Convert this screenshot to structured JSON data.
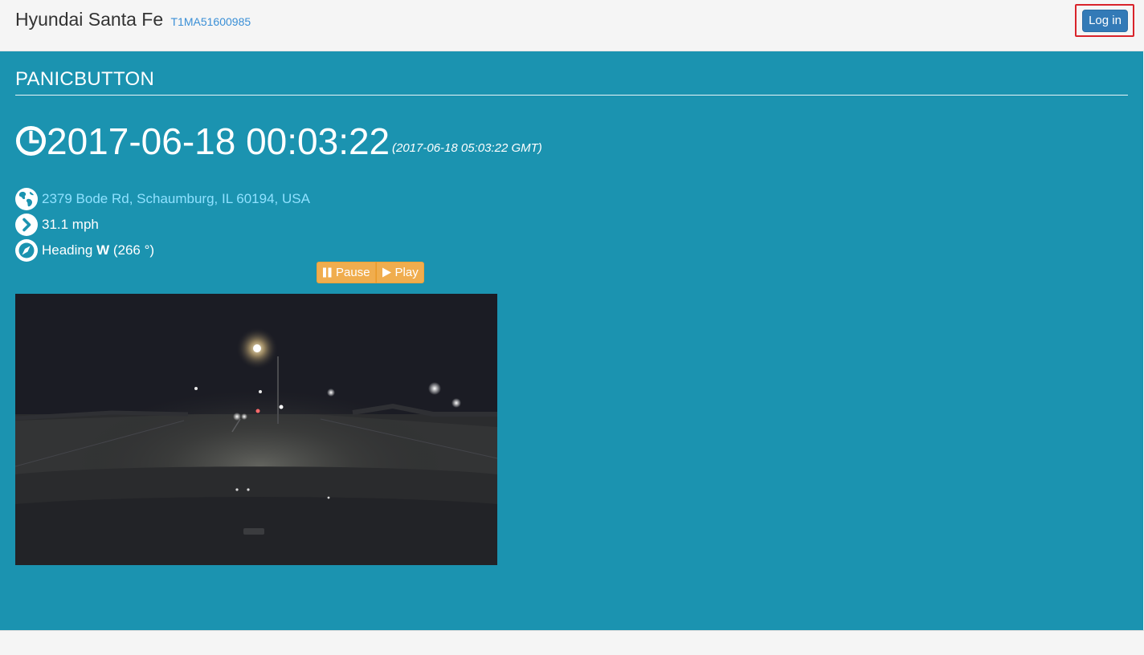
{
  "header": {
    "vehicle_name": "Hyundai Santa Fe",
    "vin": "T1MA51600985",
    "login_label": "Log in"
  },
  "event": {
    "type": "PANICBUTTON",
    "local_time": "2017-06-18 00:03:22",
    "gmt_time": "(2017-06-18 05:03:22 GMT)",
    "address": "2379 Bode Rd, Schaumburg, IL 60194, USA",
    "speed": "31.1 mph",
    "heading_prefix": "Heading",
    "heading_dir": "W",
    "heading_deg": "(266 °)"
  },
  "controls": {
    "pause_label": "Pause",
    "play_label": "Play"
  },
  "icons": {
    "time": "clock-icon",
    "address": "globe-icon",
    "speed": "chevron-right-icon",
    "heading": "compass-icon",
    "pause": "pause-icon",
    "play": "play-icon"
  },
  "colors": {
    "panel_bg": "#1b93b0",
    "link": "#8fe1ff",
    "vin": "#3a8fd6",
    "login_bg": "#337ab7",
    "warn_bg": "#f0ad4e",
    "highlight": "#d9232a"
  }
}
